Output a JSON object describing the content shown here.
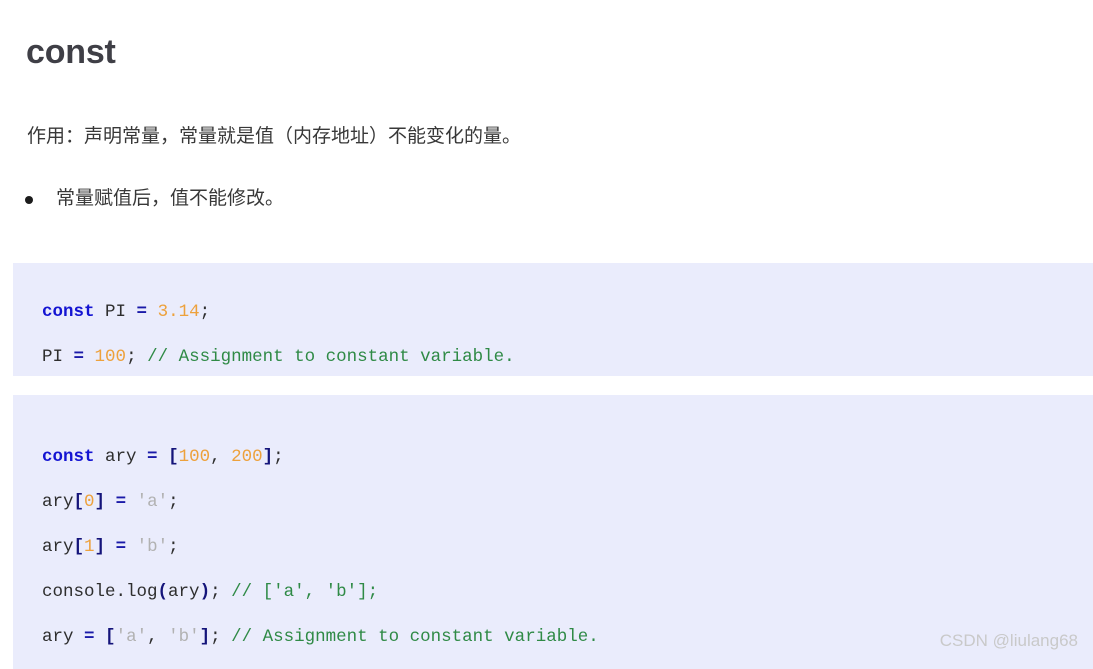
{
  "document": {
    "title": "const",
    "intro": "作用：声明常量，常量就是值（内存地址）不能变化的量。",
    "bullets": [
      "常量赋值后，值不能修改。"
    ]
  },
  "code_blocks": [
    {
      "id": "code-block-1",
      "language": "javascript",
      "lines": [
        {
          "tokens": [
            {
              "text": "const",
              "type": "keyword"
            },
            {
              "text": " PI ",
              "type": "plain"
            },
            {
              "text": "=",
              "type": "operator"
            },
            {
              "text": " ",
              "type": "plain"
            },
            {
              "text": "3.14",
              "type": "number"
            },
            {
              "text": ";",
              "type": "plain"
            }
          ]
        },
        {
          "tokens": [
            {
              "text": "PI ",
              "type": "plain"
            },
            {
              "text": "=",
              "type": "operator"
            },
            {
              "text": " ",
              "type": "plain"
            },
            {
              "text": "100",
              "type": "number"
            },
            {
              "text": "; ",
              "type": "plain"
            },
            {
              "text": "// Assignment to constant variable.",
              "type": "comment"
            }
          ]
        }
      ]
    },
    {
      "id": "code-block-2",
      "language": "javascript",
      "lines": [
        {
          "tokens": [
            {
              "text": "const",
              "type": "keyword"
            },
            {
              "text": " ary ",
              "type": "plain"
            },
            {
              "text": "=",
              "type": "operator"
            },
            {
              "text": " ",
              "type": "plain"
            },
            {
              "text": "[",
              "type": "punctuation"
            },
            {
              "text": "100",
              "type": "number"
            },
            {
              "text": ", ",
              "type": "plain"
            },
            {
              "text": "200",
              "type": "number"
            },
            {
              "text": "]",
              "type": "punctuation"
            },
            {
              "text": ";",
              "type": "plain"
            }
          ]
        },
        {
          "tokens": [
            {
              "text": "ary",
              "type": "plain"
            },
            {
              "text": "[",
              "type": "punctuation"
            },
            {
              "text": "0",
              "type": "number"
            },
            {
              "text": "]",
              "type": "punctuation"
            },
            {
              "text": " ",
              "type": "plain"
            },
            {
              "text": "=",
              "type": "operator"
            },
            {
              "text": " ",
              "type": "plain"
            },
            {
              "text": "'a'",
              "type": "string"
            },
            {
              "text": ";",
              "type": "plain"
            }
          ]
        },
        {
          "tokens": [
            {
              "text": "ary",
              "type": "plain"
            },
            {
              "text": "[",
              "type": "punctuation"
            },
            {
              "text": "1",
              "type": "number"
            },
            {
              "text": "]",
              "type": "punctuation"
            },
            {
              "text": " ",
              "type": "plain"
            },
            {
              "text": "=",
              "type": "operator"
            },
            {
              "text": " ",
              "type": "plain"
            },
            {
              "text": "'b'",
              "type": "string"
            },
            {
              "text": ";",
              "type": "plain"
            }
          ]
        },
        {
          "tokens": [
            {
              "text": "console.log",
              "type": "plain"
            },
            {
              "text": "(",
              "type": "punctuation"
            },
            {
              "text": "ary",
              "type": "plain"
            },
            {
              "text": ")",
              "type": "punctuation"
            },
            {
              "text": "; ",
              "type": "plain"
            },
            {
              "text": "// ['a', 'b'];",
              "type": "comment"
            }
          ]
        },
        {
          "tokens": [
            {
              "text": "ary ",
              "type": "plain"
            },
            {
              "text": "=",
              "type": "operator"
            },
            {
              "text": " ",
              "type": "plain"
            },
            {
              "text": "[",
              "type": "punctuation"
            },
            {
              "text": "'a'",
              "type": "string"
            },
            {
              "text": ", ",
              "type": "plain"
            },
            {
              "text": "'b'",
              "type": "string"
            },
            {
              "text": "]",
              "type": "punctuation"
            },
            {
              "text": "; ",
              "type": "plain"
            },
            {
              "text": "// Assignment to constant variable.",
              "type": "comment"
            }
          ]
        }
      ]
    }
  ],
  "watermark": {
    "text": "CSDN @liulang68"
  },
  "colors": {
    "code_background": "#eaecfc",
    "keyword": "#1414d2",
    "operator": "#1a1aa8",
    "punctuation": "#14147a",
    "number": "#eda13c",
    "string": "#b2b2b2",
    "comment": "#2f8a46",
    "body_text": "#383838",
    "title_text": "#3f3f46",
    "watermark": "#c9c9c9"
  }
}
